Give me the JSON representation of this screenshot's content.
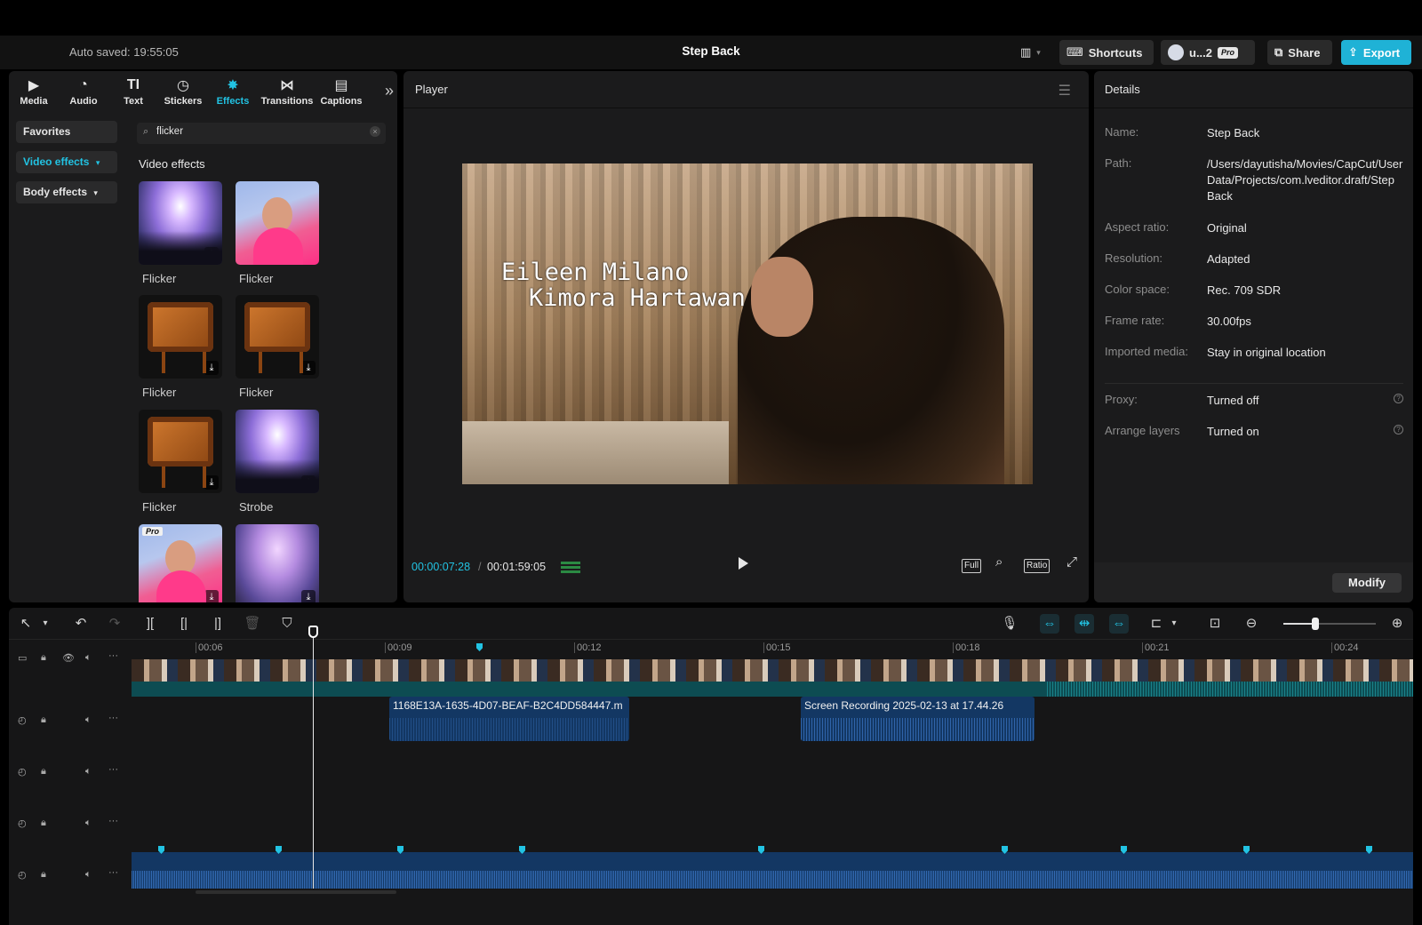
{
  "topbar": {
    "autosave": "Auto saved: 19:55:05",
    "project_title": "Step Back",
    "shortcuts": "Shortcuts",
    "user": "u...2",
    "pro_badge": "Pro",
    "share": "Share",
    "export": "Export",
    "accent_color": "#1fb2d6"
  },
  "left_panel": {
    "tabs": [
      {
        "label": "Media",
        "icon": "media-icon"
      },
      {
        "label": "Audio",
        "icon": "audio-icon"
      },
      {
        "label": "Text",
        "icon": "text-icon"
      },
      {
        "label": "Stickers",
        "icon": "stickers-icon"
      },
      {
        "label": "Effects",
        "icon": "effects-icon",
        "active": true
      },
      {
        "label": "Transitions",
        "icon": "transitions-icon"
      },
      {
        "label": "Captions",
        "icon": "captions-icon"
      }
    ],
    "categories": [
      "Favorites",
      "Video effects",
      "Body effects"
    ],
    "search": {
      "value": "flicker",
      "placeholder": ""
    },
    "section_title": "Video effects",
    "effects": [
      {
        "label": "Flicker",
        "thumb": "concert"
      },
      {
        "label": "Flicker",
        "thumb": "woman"
      },
      {
        "label": "Flicker",
        "thumb": "tv"
      },
      {
        "label": "Flicker",
        "thumb": "tv"
      },
      {
        "label": "Flicker",
        "thumb": "tv"
      },
      {
        "label": "Strobe",
        "thumb": "concert"
      },
      {
        "label": "",
        "thumb": "woman",
        "pro": "Pro"
      },
      {
        "label": "",
        "thumb": "purple"
      }
    ]
  },
  "player": {
    "title": "Player",
    "overlay_text_line1": "Eileen Milano",
    "overlay_text_line2": "Kimora Hartawan",
    "time_current": "00:00:07:28",
    "time_total": "00:01:59:05",
    "full_label": "Full",
    "ratio_label": "Ratio"
  },
  "details": {
    "title": "Details",
    "rows": [
      {
        "label": "Name:",
        "value": "Step Back"
      },
      {
        "label": "Path:",
        "value": "/Users/dayutisha/Movies/CapCut/User Data/Projects/com.lveditor.draft/Step Back"
      },
      {
        "label": "Aspect ratio:",
        "value": "Original"
      },
      {
        "label": "Resolution:",
        "value": "Adapted"
      },
      {
        "label": "Color space:",
        "value": "Rec. 709 SDR"
      },
      {
        "label": "Frame rate:",
        "value": "30.00fps"
      },
      {
        "label": "Imported media:",
        "value": "Stay in original location"
      },
      {
        "label": "Proxy:",
        "value": "Turned off"
      },
      {
        "label": "Arrange layers",
        "value": "Turned on"
      }
    ],
    "modify": "Modify"
  },
  "timeline": {
    "ruler": [
      "00:06",
      "00:09",
      "00:12",
      "00:15",
      "00:18",
      "00:21",
      "00:24"
    ],
    "clips": [
      {
        "name": "1168E13A-1635-4D07-BEAF-B2C4DD584447.m"
      },
      {
        "name": "Screen Recording 2025-02-13 at 17.44.26"
      }
    ],
    "clip_color": "#133763",
    "main_track_color": "#0d4c52"
  }
}
